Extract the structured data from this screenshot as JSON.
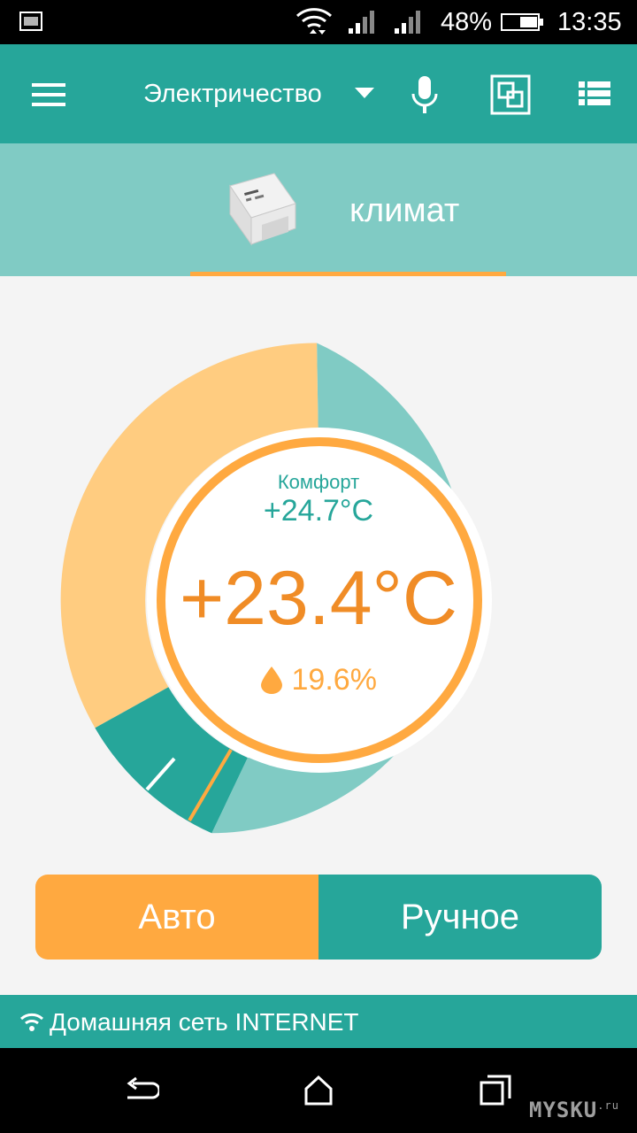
{
  "status_bar": {
    "battery_percent": "48%",
    "time": "13:35",
    "icons": [
      "screenshot-icon",
      "wifi-icon",
      "signal-icon",
      "signal-icon",
      "battery-icon"
    ]
  },
  "app_bar": {
    "title": "Электричество",
    "icons": [
      "menu-icon",
      "dropdown-icon",
      "mic-icon",
      "scene-icon",
      "list-icon"
    ]
  },
  "device_tab": {
    "label": "климат",
    "icon": "relay-device-icon"
  },
  "dial": {
    "comfort_label": "Комфорт",
    "comfort_value": "+24.7°C",
    "current_temp": "+23.4°C",
    "humidity": "19.6%",
    "colors": {
      "warm": "#ffcc80",
      "cool": "#80cbc4",
      "teal": "#26a69a",
      "orange": "#ffa940",
      "temp_text": "#f08c26"
    }
  },
  "modes": {
    "auto_label": "Авто",
    "manual_label": "Ручное"
  },
  "network": {
    "text": "Домашняя сеть INTERNET",
    "icon": "wifi-icon"
  },
  "nav_bar": {
    "icons": [
      "back-icon",
      "home-icon",
      "recents-icon"
    ]
  },
  "watermark": {
    "text": "MYSKU",
    "suffix": ".ru"
  },
  "colors": {
    "primary": "#26a69a",
    "primary_light": "#80cbc4",
    "accent": "#ffa940"
  }
}
